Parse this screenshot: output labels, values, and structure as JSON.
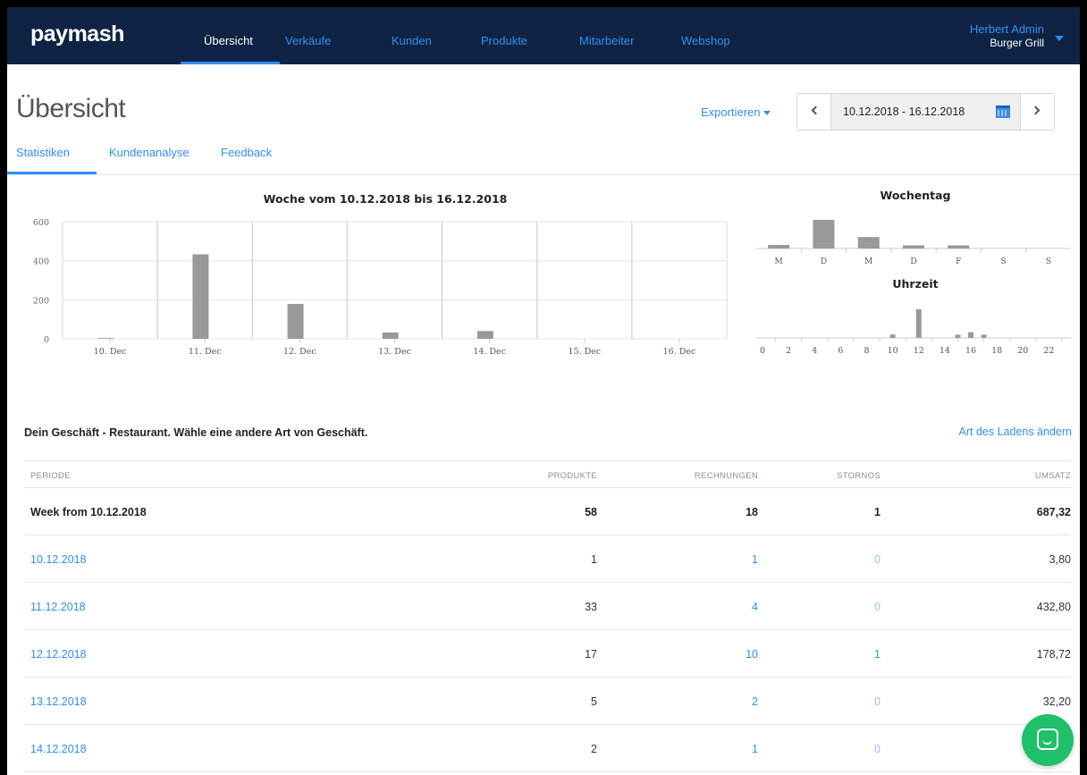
{
  "app": {
    "logo": "paymash"
  },
  "nav": {
    "items": [
      {
        "label": "Übersicht",
        "active": true
      },
      {
        "label": "Verkäufe"
      },
      {
        "label": "Kunden"
      },
      {
        "label": "Produkte"
      },
      {
        "label": "Mitarbeiter"
      },
      {
        "label": "Webshop"
      }
    ],
    "user": {
      "name": "Herbert Admin",
      "shop": "Burger Grill"
    }
  },
  "page": {
    "title": "Übersicht",
    "export_label": "Exportieren",
    "date_range": "10.12.2018 - 16.12.2018",
    "tabs": [
      {
        "label": "Statistiken",
        "active": true
      },
      {
        "label": "Kundenanalyse"
      },
      {
        "label": "Feedback"
      }
    ]
  },
  "colors": {
    "accent": "#2e8ff0",
    "nav_bg": "#0f2444",
    "bar": "#999999",
    "chat": "#20bf6b"
  },
  "icons": [
    "chevron-left-icon",
    "chevron-right-icon",
    "calendar-icon",
    "caret-down-icon",
    "chat-icon"
  ],
  "business": {
    "text": "Dein Geschäft - Restaurant. Wähle eine andere Art von Geschäft.",
    "link": "Art des Ladens ändern"
  },
  "table": {
    "headers": [
      "PERIODE",
      "PRODUKTE",
      "RECHNUNGEN",
      "STORNOS",
      "UMSATZ"
    ],
    "total": {
      "period": "Week from 10.12.2018",
      "products": "58",
      "invoices": "18",
      "cancellations": "1",
      "revenue": "687,32"
    },
    "rows": [
      {
        "period": "10.12.2018",
        "products": "1",
        "invoices": "1",
        "cancellations": "0",
        "revenue": "3,80"
      },
      {
        "period": "11.12.2018",
        "products": "33",
        "invoices": "4",
        "cancellations": "0",
        "revenue": "432,80"
      },
      {
        "period": "12.12.2018",
        "products": "17",
        "invoices": "10",
        "cancellations": "1",
        "revenue": "178,72"
      },
      {
        "period": "13.12.2018",
        "products": "5",
        "invoices": "2",
        "cancellations": "0",
        "revenue": "32,20"
      },
      {
        "period": "14.12.2018",
        "products": "2",
        "invoices": "1",
        "cancellations": "0",
        "revenue": ""
      }
    ]
  },
  "chart_data": [
    {
      "type": "bar",
      "title": "Woche vom 10.12.2018 bis 16.12.2018",
      "categories": [
        "10. Dec",
        "11. Dec",
        "12. Dec",
        "13. Dec",
        "14. Dec",
        "15. Dec",
        "16. Dec"
      ],
      "values": [
        3.8,
        432.8,
        178.72,
        32.2,
        40,
        0,
        0
      ],
      "ylim": [
        0,
        600
      ],
      "yticks": [
        0,
        200,
        400,
        600
      ],
      "grid": true
    },
    {
      "type": "bar",
      "title": "Wochentag",
      "categories": [
        "M",
        "D",
        "M",
        "D",
        "F",
        "S",
        "S"
      ],
      "values": [
        25,
        200,
        80,
        22,
        22,
        0,
        0
      ]
    },
    {
      "type": "bar",
      "title": "Uhrzeit",
      "categories": [
        "0",
        "1",
        "2",
        "3",
        "4",
        "5",
        "6",
        "7",
        "8",
        "9",
        "10",
        "11",
        "12",
        "13",
        "14",
        "15",
        "16",
        "17",
        "18",
        "19",
        "20",
        "21",
        "22",
        "23"
      ],
      "tick_labels": [
        "0",
        "2",
        "4",
        "6",
        "8",
        "10",
        "12",
        "14",
        "16",
        "18",
        "20",
        "22"
      ],
      "values": [
        0,
        0,
        0,
        0,
        0,
        0,
        0,
        0,
        0,
        0,
        15,
        0,
        125,
        0,
        0,
        14,
        25,
        14,
        0,
        0,
        0,
        0,
        0,
        0
      ]
    }
  ]
}
